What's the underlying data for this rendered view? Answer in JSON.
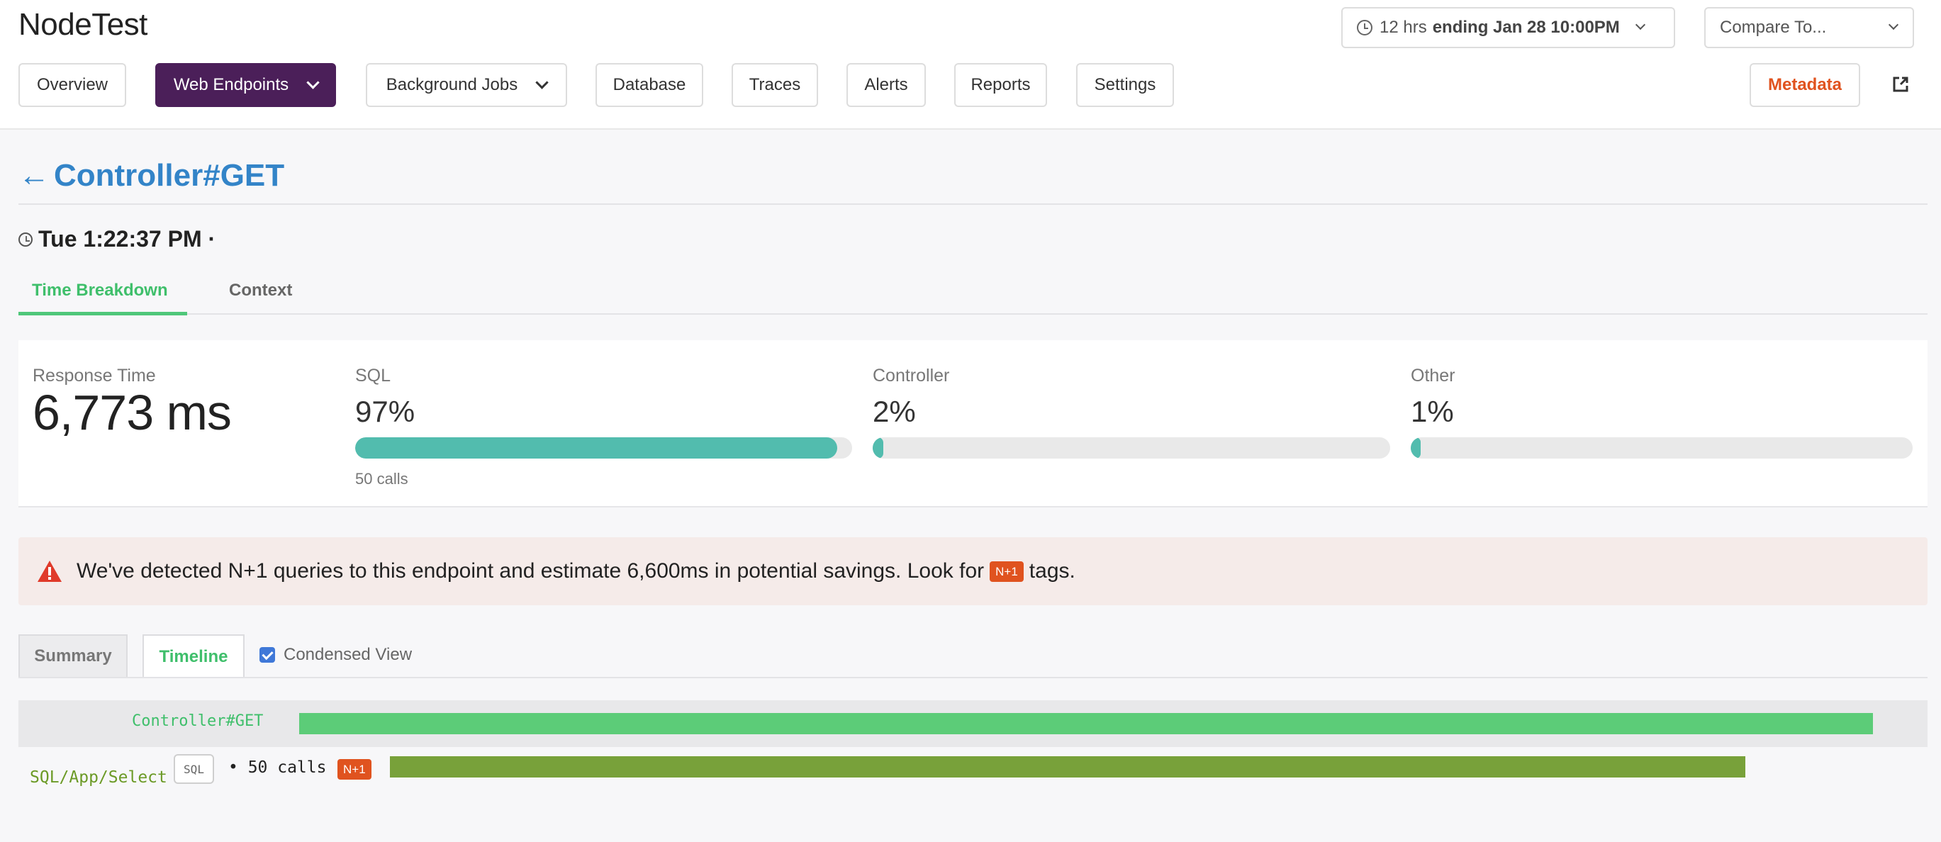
{
  "app": {
    "title": "NodeTest"
  },
  "nav": {
    "overview": "Overview",
    "web_endpoints": "Web Endpoints",
    "background_jobs": "Background Jobs",
    "database": "Database",
    "traces": "Traces",
    "alerts": "Alerts",
    "reports": "Reports",
    "settings": "Settings",
    "metadata": "Metadata"
  },
  "time_range": {
    "prefix": "12 hrs",
    "bold": "ending Jan 28 10:00PM"
  },
  "compare": {
    "label": "Compare To..."
  },
  "page": {
    "title": "Controller#GET",
    "back": "←",
    "trace_time": "Tue 1:22:37 PM ·"
  },
  "tabs": {
    "breakdown": "Time Breakdown",
    "context": "Context"
  },
  "metrics": {
    "response": {
      "label": "Response Time",
      "value": "6,773 ms"
    },
    "sql": {
      "label": "SQL",
      "value": "97%",
      "fraction": 0.97,
      "sub": "50 calls"
    },
    "controller": {
      "label": "Controller",
      "value": "2%",
      "fraction": 0.02
    },
    "other": {
      "label": "Other",
      "value": "1%",
      "fraction": 0.01
    }
  },
  "alert": {
    "text_before": "We've detected N+1 queries to this endpoint and estimate 6,600ms in potential savings. Look for",
    "tag": "N+1",
    "text_after": "tags."
  },
  "view_tabs": {
    "summary": "Summary",
    "timeline": "Timeline",
    "condensed": "Condensed View",
    "condensed_checked": true
  },
  "timeline": {
    "rows": [
      {
        "label": "Controller#GET"
      },
      {
        "label": "SQL/App/Select",
        "tag": "SQL",
        "calls": "• 50 calls",
        "badge": "N+1"
      }
    ]
  },
  "colors": {
    "brand": "#4b1f59",
    "link": "#3384c8",
    "success": "#5ccc78",
    "sql_bar": "#78a13a",
    "n1_badge": "#e0531f",
    "metric_bar": "#52bcae"
  }
}
